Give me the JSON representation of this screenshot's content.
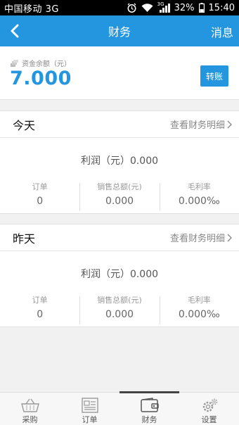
{
  "status_bar": {
    "carrier": "中国移动 3G",
    "battery": "32%",
    "time": "15:40",
    "network": "3G"
  },
  "nav": {
    "title": "财务",
    "right_label": "消息"
  },
  "balance": {
    "label": "资金余额（元）",
    "amount": "7.000",
    "transfer_label": "转账"
  },
  "days": [
    {
      "label": "今天",
      "detail_link": "查看财务明细",
      "profit": "利润（元）0.000",
      "stats": [
        {
          "label": "订单",
          "value": "0"
        },
        {
          "label": "销售总额(元)",
          "value": "0.000"
        },
        {
          "label": "毛利率",
          "value": "0.000‰"
        }
      ]
    },
    {
      "label": "昨天",
      "detail_link": "查看财务明细",
      "profit": "利润（元）0.000",
      "stats": [
        {
          "label": "订单",
          "value": "0"
        },
        {
          "label": "销售总额(元)",
          "value": "0.000"
        },
        {
          "label": "毛利率",
          "value": "0.000‰"
        }
      ]
    }
  ],
  "tabs": [
    {
      "label": "采购",
      "icon": "basket-icon"
    },
    {
      "label": "订单",
      "icon": "order-list-icon"
    },
    {
      "label": "财务",
      "icon": "wallet-icon",
      "active": true
    },
    {
      "label": "设置",
      "icon": "gear-icon"
    }
  ]
}
